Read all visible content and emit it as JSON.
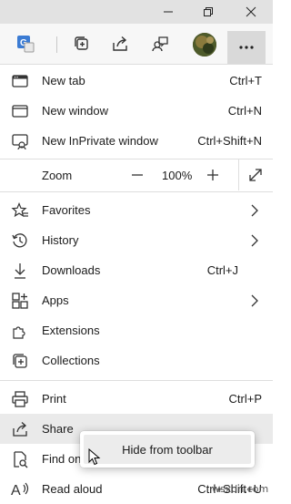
{
  "window_controls": {
    "minimize_icon": "minimize-icon",
    "restore_icon": "restore-icon",
    "close_icon": "close-icon"
  },
  "toolbar": {
    "icons": [
      "translate-icon",
      "collections-icon",
      "share-icon",
      "feedback-icon",
      "profile-avatar",
      "more-icon"
    ],
    "accent": "#3b7bd3"
  },
  "menu": {
    "items_top": [
      {
        "label": "New tab",
        "shortcut": "Ctrl+T",
        "icon": "new-tab-icon"
      },
      {
        "label": "New window",
        "shortcut": "Ctrl+N",
        "icon": "new-window-icon"
      },
      {
        "label": "New InPrivate window",
        "shortcut": "Ctrl+Shift+N",
        "icon": "inprivate-icon"
      }
    ],
    "zoom": {
      "label": "Zoom",
      "value": "100%",
      "minus": "−",
      "plus": "+"
    },
    "items_mid": [
      {
        "label": "Favorites",
        "icon": "favorites-icon",
        "submenu": true
      },
      {
        "label": "History",
        "icon": "history-icon",
        "submenu": true
      },
      {
        "label": "Downloads",
        "shortcut": "Ctrl+J",
        "icon": "downloads-icon"
      },
      {
        "label": "Apps",
        "icon": "apps-icon",
        "submenu": true
      },
      {
        "label": "Extensions",
        "icon": "extensions-icon"
      },
      {
        "label": "Collections",
        "icon": "collections-icon"
      }
    ],
    "items_bottom": [
      {
        "label": "Print",
        "shortcut": "Ctrl+P",
        "icon": "print-icon"
      },
      {
        "label": "Share",
        "icon": "share-icon"
      },
      {
        "label": "Find on",
        "icon": "find-icon"
      },
      {
        "label": "Read aloud",
        "shortcut": "Ctrl+Shift+U",
        "icon": "read-aloud-icon"
      }
    ]
  },
  "popup": {
    "label": "Hide from toolbar"
  },
  "watermark": "wsxdn.com"
}
